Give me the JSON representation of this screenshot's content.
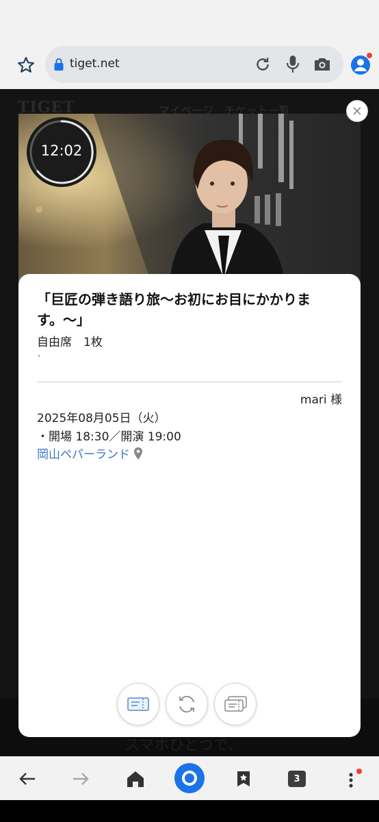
{
  "browser": {
    "url": "tiget.net",
    "tab_count": "3"
  },
  "background_page": {
    "logo": "TIGET",
    "nav_text": "マイページ　チケット一覧",
    "footer_text": "スマホひとつで、"
  },
  "ticket": {
    "timer": "12:02",
    "event_title": "「巨匠の弾き語り旅〜お初にお目にかかります。〜」",
    "seat": "自由席　1枚",
    "holder": "mari 様",
    "date": "2025年08月05日（火）",
    "times": "・開場 18:30／開演 19:00",
    "venue": "岡山ペパーランド"
  },
  "colors": {
    "accent": "#1a73e8",
    "link": "#3b74c4",
    "notification": "#ea4335"
  }
}
